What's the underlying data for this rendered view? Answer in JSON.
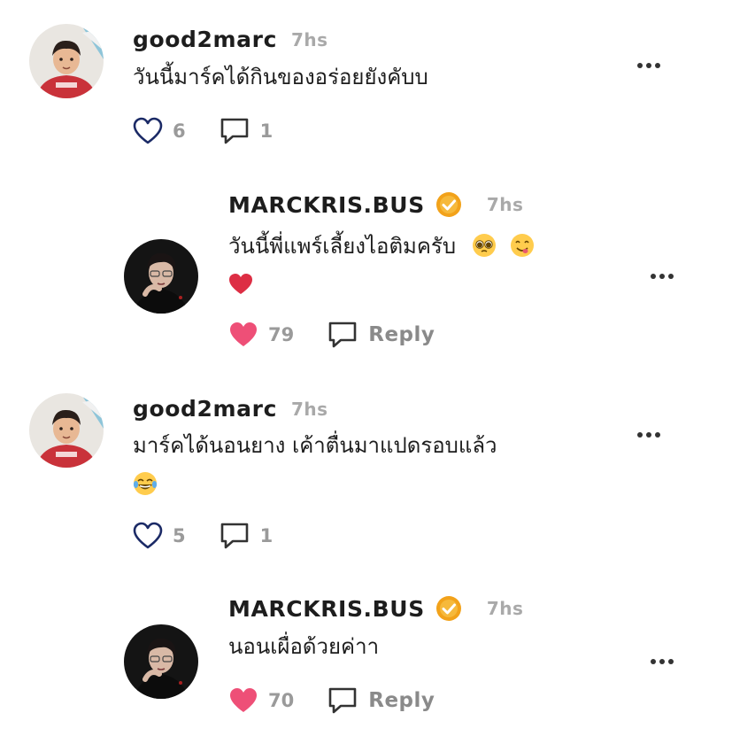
{
  "colors": {
    "heart_outline": "#1b2a66",
    "heart_liked": "#ee4f77",
    "verified_badge": "#f2a21a",
    "muted_text": "#9a9a9a"
  },
  "comments": [
    {
      "username": "good2marc",
      "time": "7hs",
      "verified": false,
      "lines": [
        "วันนี้มาร์คได้กินของอร่อยยังคับบ"
      ],
      "likes": "6",
      "liked": false,
      "second_action": "1",
      "second_icon": "comment-icon"
    },
    {
      "username": "MARCKRIS.BUS",
      "time": "7hs",
      "verified": true,
      "lines": [
        "วันนี้พี่แพร์เลี้ยงไอติมครับ"
      ],
      "line_emojis": [
        "pleading-face",
        "yum-face"
      ],
      "extra_emoji": "red-heart",
      "likes": "79",
      "liked": true,
      "second_action": "Reply",
      "second_icon": "reply-icon"
    },
    {
      "username": "good2marc",
      "time": "7hs",
      "verified": false,
      "lines": [
        "มาร์คได้นอนยาง เค้าตื่นมาแปดรอบแล้ว"
      ],
      "extra_emoji": "tears-of-joy",
      "likes": "5",
      "liked": false,
      "second_action": "1",
      "second_icon": "comment-icon"
    },
    {
      "username": "MARCKRIS.BUS",
      "time": "7hs",
      "verified": true,
      "lines": [
        "นอนเผื่อด้วยค่าา"
      ],
      "likes": "70",
      "liked": true,
      "second_action": "Reply",
      "second_icon": "reply-icon"
    }
  ]
}
